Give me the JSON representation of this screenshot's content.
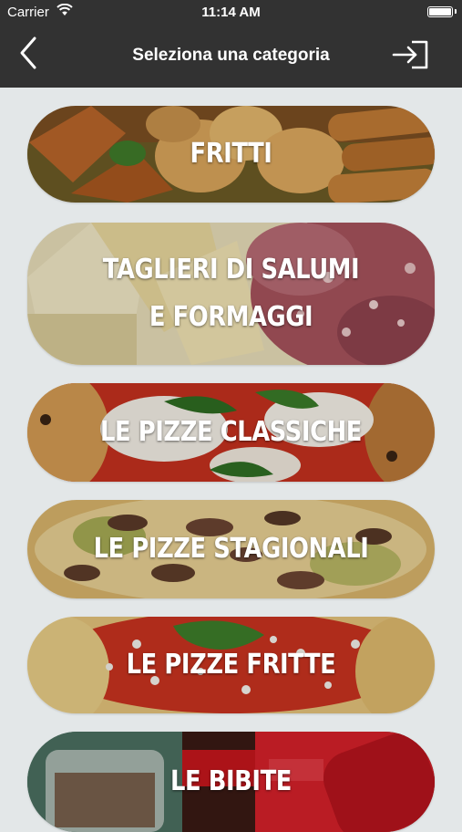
{
  "status_bar": {
    "carrier": "Carrier",
    "time": "11:14 AM",
    "wifi_icon": "wifi-icon",
    "battery_icon": "battery-icon"
  },
  "nav": {
    "title": "Seleziona una categoria",
    "back_icon": "chevron-left-icon",
    "login_icon": "sign-in-icon"
  },
  "categories": [
    {
      "line1": "FRITTI",
      "line2": ""
    },
    {
      "line1": "TAGLIERI DI SALUMI",
      "line2": "E FORMAGGI"
    },
    {
      "line1": "LE PIZZE CLASSICHE",
      "line2": ""
    },
    {
      "line1": "LE PIZZE STAGIONALI",
      "line2": ""
    },
    {
      "line1": "LE PIZZE FRITTE",
      "line2": ""
    },
    {
      "line1": "LE BIBITE",
      "line2": ""
    }
  ],
  "colors": {
    "nav_background": "#323232",
    "page_background": "#e3e7e8",
    "label_text": "#ffffff"
  }
}
